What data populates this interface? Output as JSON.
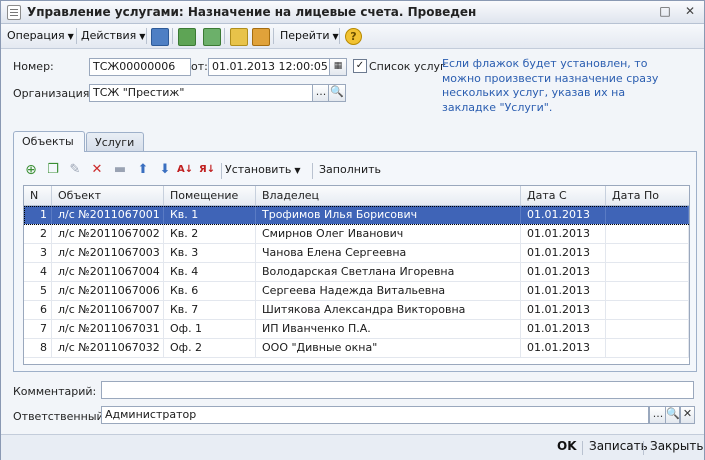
{
  "window": {
    "title": "Управление услугами: Назначение на лицевые счета. Проведен"
  },
  "window_buttons": [
    "□",
    "✕"
  ],
  "toolbar": {
    "operation_label": "Операция",
    "actions_label": "Действия",
    "goto_label": "Перейти",
    "help_label": "?"
  },
  "form": {
    "number_label": "Номер:",
    "number_value": "ТСЖ00000006",
    "from_label": "от:",
    "date_value": "01.01.2013 12:00:05",
    "services_list_label": "Список услуг",
    "org_label": "Организация:",
    "org_value": "ТСЖ \"Престиж\"",
    "select_symbol": "...",
    "search_symbol": "🔍",
    "hint": "Если флажок будет установлен, то можно произвести назначение сразу нескольких услуг, указав их на закладке \"Услуги\".",
    "comment_label": "Комментарий:",
    "comment_value": "",
    "responsible_label": "Ответственный:",
    "responsible_value": "Администратор",
    "clear_symbol": "✕"
  },
  "tabs": [
    {
      "label": "Объекты",
      "active": true
    },
    {
      "label": "Услуги",
      "active": false
    }
  ],
  "grid_toolbar": {
    "set_label": "Установить",
    "fill_label": "Заполнить"
  },
  "grid": {
    "columns": [
      "N",
      "Объект",
      "Помещение",
      "Владелец",
      "Дата С",
      "Дата По"
    ],
    "rows": [
      [
        "1",
        "л/с №2011067001",
        "Кв. 1",
        "Трофимов Илья Борисович",
        "01.01.2013",
        ""
      ],
      [
        "2",
        "л/с №2011067002",
        "Кв. 2",
        "Смирнов Олег Иванович",
        "01.01.2013",
        ""
      ],
      [
        "3",
        "л/с №2011067003",
        "Кв. 3",
        "Чанова Елена Сергеевна",
        "01.01.2013",
        ""
      ],
      [
        "4",
        "л/с №2011067004",
        "Кв. 4",
        "Володарская Светлана Игоревна",
        "01.01.2013",
        ""
      ],
      [
        "5",
        "л/с №2011067006",
        "Кв. 6",
        "Сергеева Надежда Витальевна",
        "01.01.2013",
        ""
      ],
      [
        "6",
        "л/с №2011067007",
        "Кв. 7",
        "Шитякова Александра Викторовна",
        "01.01.2013",
        ""
      ],
      [
        "7",
        "л/с №2011067031",
        "Оф. 1",
        "ИП Иванченко П.А.",
        "01.01.2013",
        ""
      ],
      [
        "8",
        "л/с №2011067032",
        "Оф. 2",
        "ООО \"Дивные окна\"",
        "01.01.2013",
        ""
      ]
    ]
  },
  "footer": {
    "ok_label": "OK",
    "save_label": "Записать",
    "close_label": "Закрыть"
  }
}
